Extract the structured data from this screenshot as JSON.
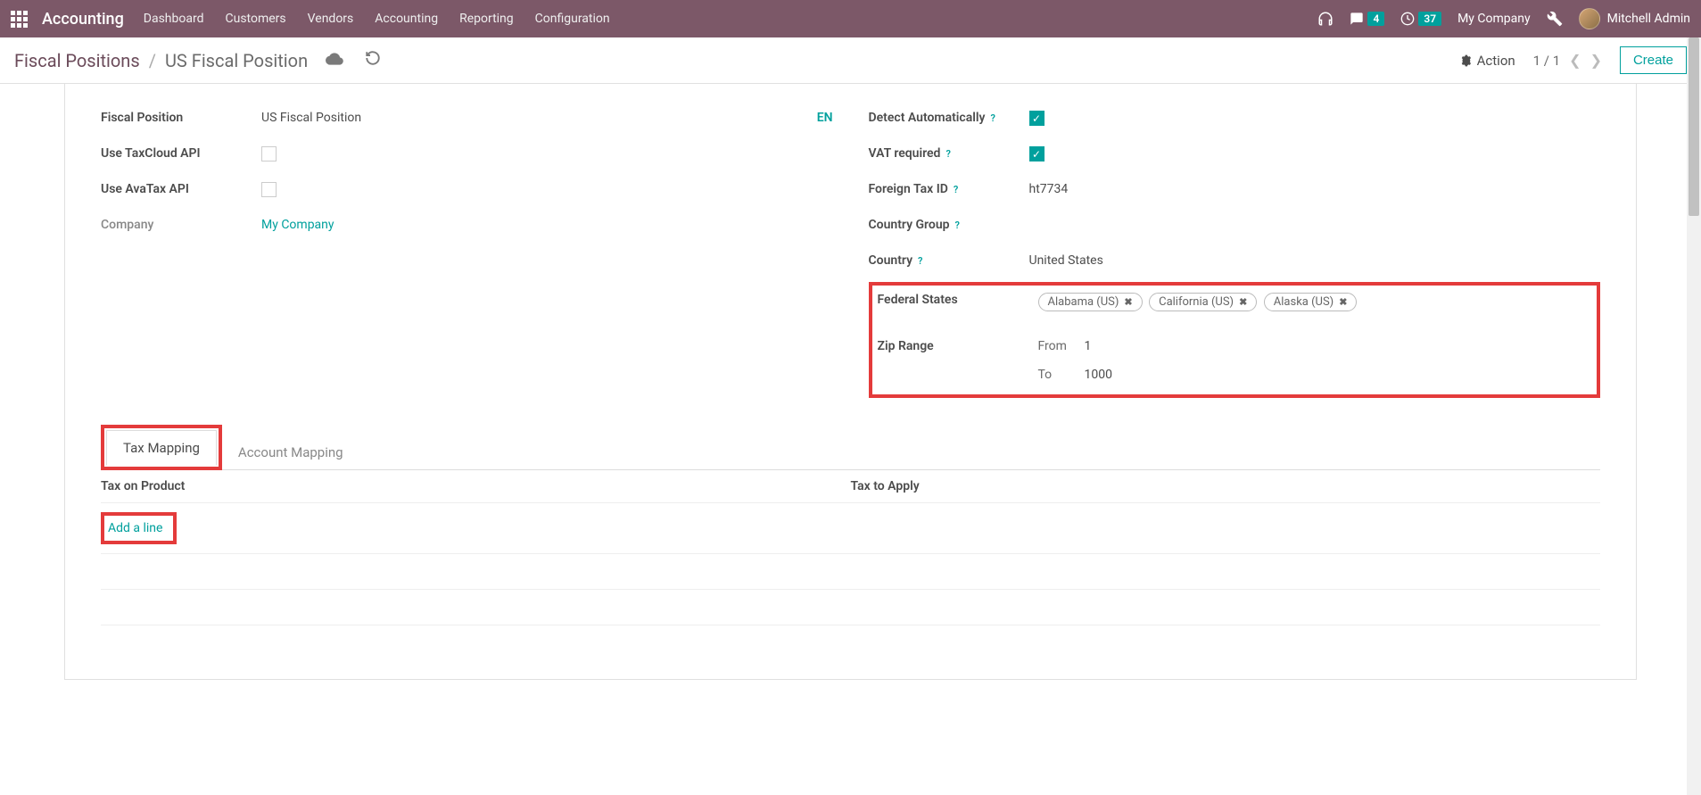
{
  "topbar": {
    "brand": "Accounting",
    "nav": [
      "Dashboard",
      "Customers",
      "Vendors",
      "Accounting",
      "Reporting",
      "Configuration"
    ],
    "msg_badge": "4",
    "clock_badge": "37",
    "company": "My Company",
    "user": "Mitchell Admin"
  },
  "controlbar": {
    "breadcrumb_parent": "Fiscal Positions",
    "breadcrumb_current": "US Fiscal Position",
    "action_label": "Action",
    "pager": "1 / 1",
    "create_label": "Create"
  },
  "form": {
    "left": {
      "fiscal_position_label": "Fiscal Position",
      "fiscal_position_value": "US Fiscal Position",
      "en_tag": "EN",
      "taxcloud_label": "Use TaxCloud API",
      "avatax_label": "Use AvaTax API",
      "company_label": "Company",
      "company_value": "My Company"
    },
    "right": {
      "detect_label": "Detect Automatically",
      "vat_label": "VAT required",
      "foreign_tax_label": "Foreign Tax ID",
      "foreign_tax_value": "ht7734",
      "country_group_label": "Country Group",
      "country_label": "Country",
      "country_value": "United States",
      "federal_states_label": "Federal States",
      "states": [
        "Alabama (US)",
        "California (US)",
        "Alaska (US)"
      ],
      "zip_range_label": "Zip Range",
      "from_label": "From",
      "from_value": "1",
      "to_label": "To",
      "to_value": "1000"
    }
  },
  "tabs": {
    "tax_mapping": "Tax Mapping",
    "account_mapping": "Account Mapping"
  },
  "table": {
    "col1": "Tax on Product",
    "col2": "Tax to Apply",
    "add_line": "Add a line"
  }
}
